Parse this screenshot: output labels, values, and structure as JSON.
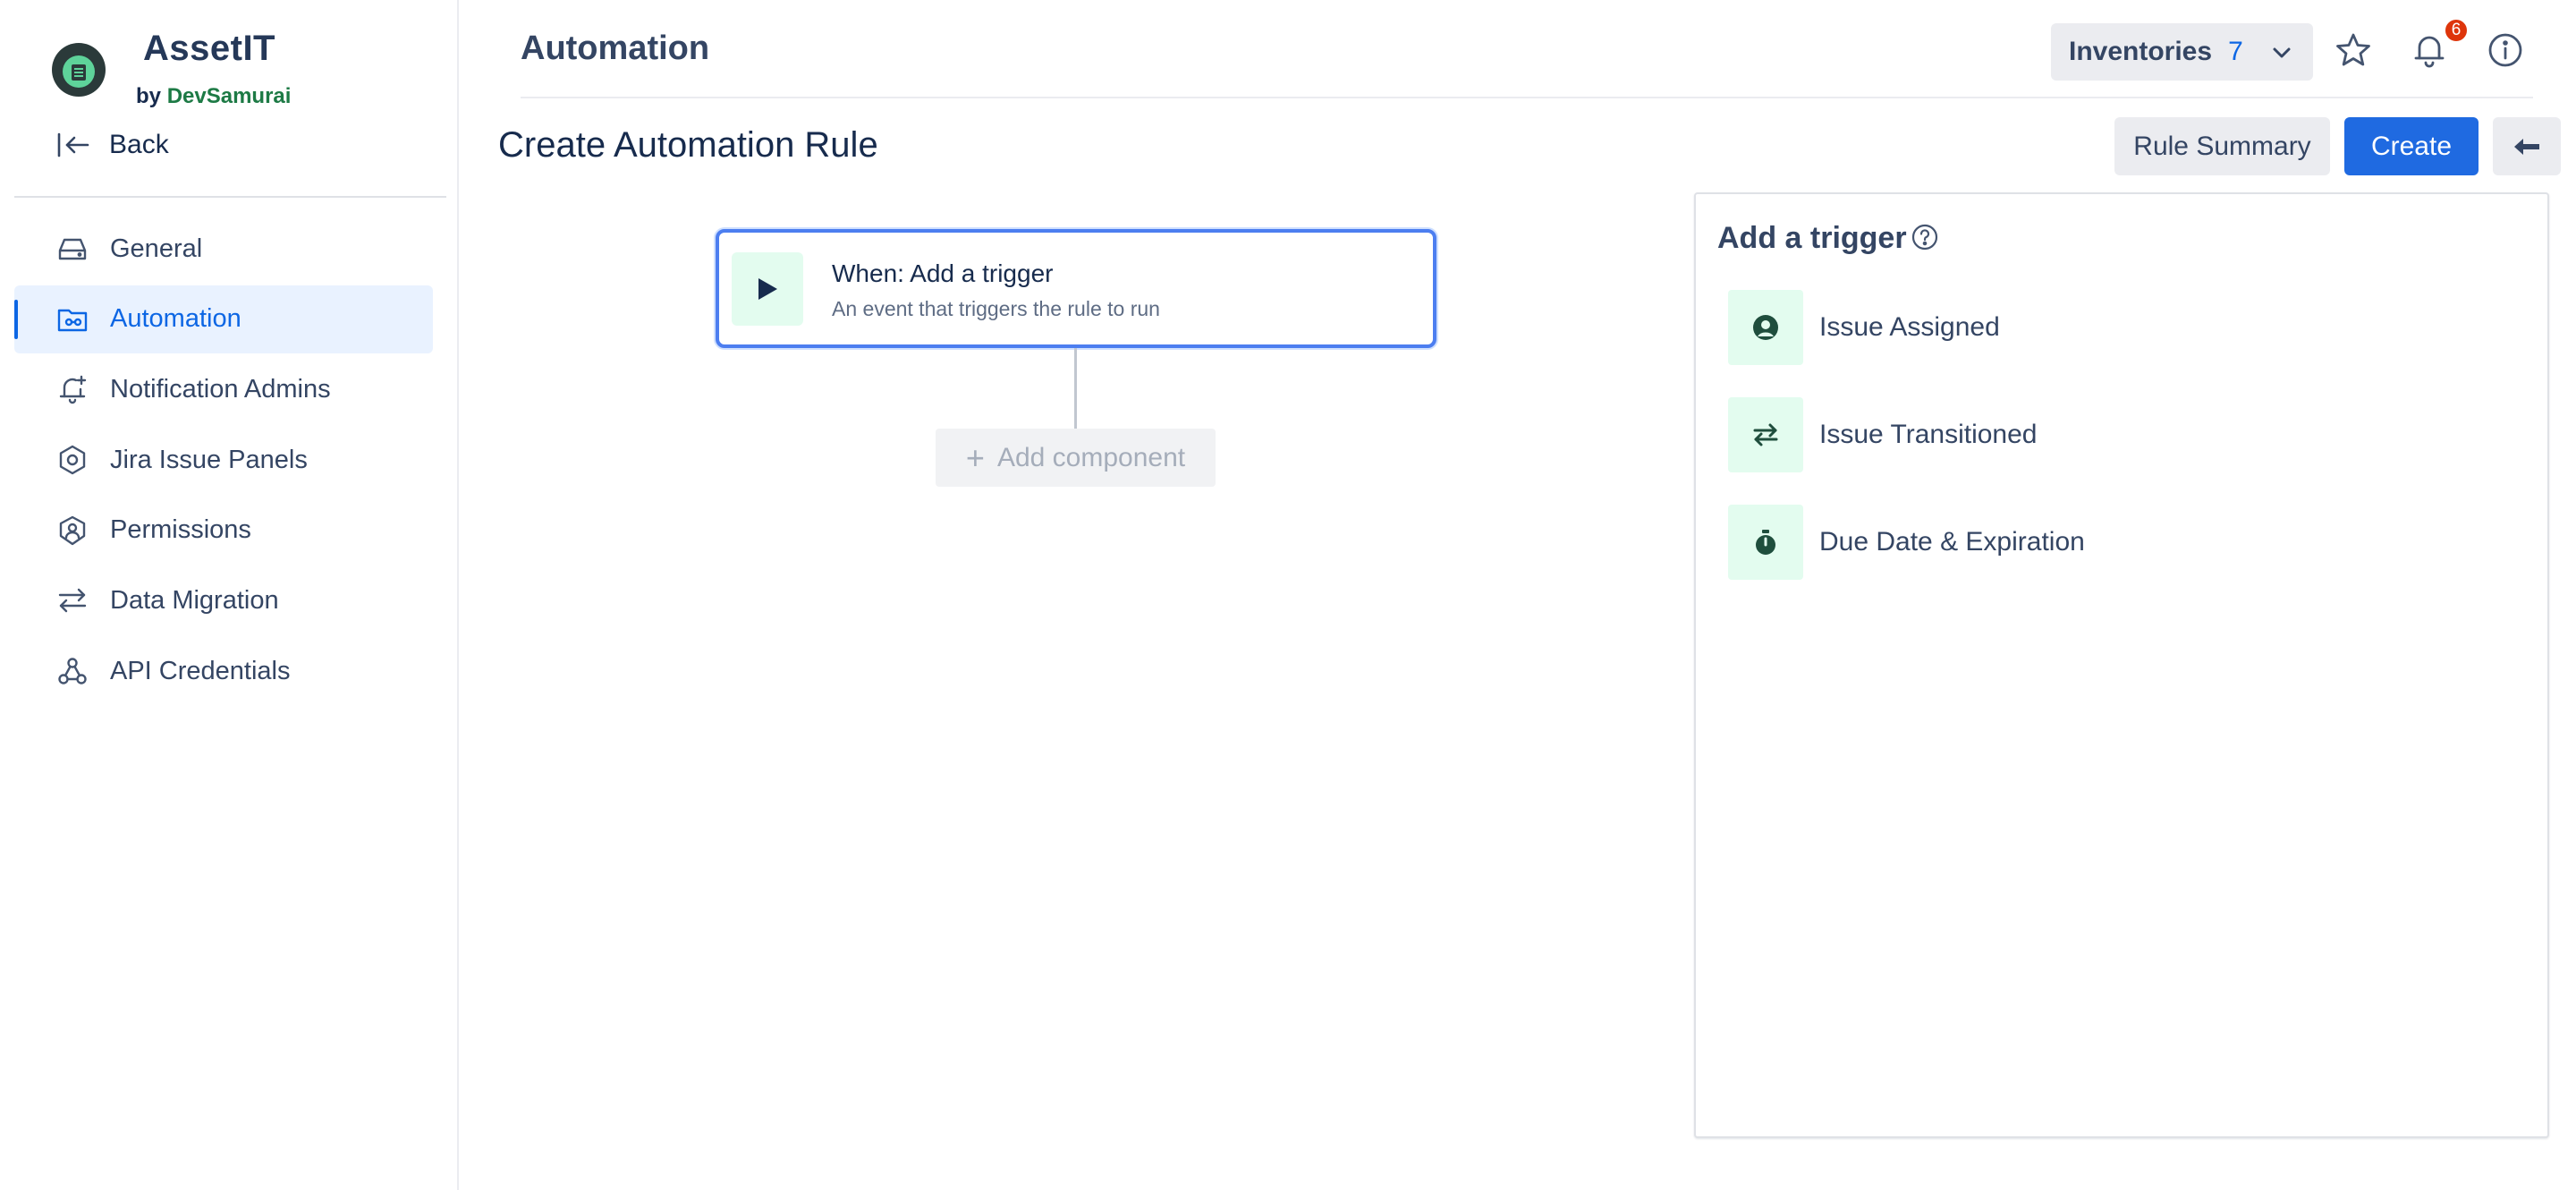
{
  "brand": {
    "name": "AssetIT",
    "by": "by",
    "company": "DevSamurai"
  },
  "sidebar": {
    "back_label": "Back",
    "items": [
      {
        "label": "General",
        "icon": "drive-icon",
        "active": false
      },
      {
        "label": "Automation",
        "icon": "automation-icon",
        "active": true
      },
      {
        "label": "Notification Admins",
        "icon": "bell-plus-icon",
        "active": false
      },
      {
        "label": "Jira Issue Panels",
        "icon": "hexagon-icon",
        "active": false
      },
      {
        "label": "Permissions",
        "icon": "shield-user-icon",
        "active": false
      },
      {
        "label": "Data Migration",
        "icon": "swap-arrows-icon",
        "active": false
      },
      {
        "label": "API Credentials",
        "icon": "webhook-icon",
        "active": false
      }
    ]
  },
  "header": {
    "title": "Automation",
    "inventories_label": "Inventories",
    "inventories_count": "7",
    "notifications_count": "6"
  },
  "subheader": {
    "title": "Create Automation Rule",
    "rule_summary_label": "Rule Summary",
    "create_label": "Create"
  },
  "canvas": {
    "trigger_title": "When: Add a trigger",
    "trigger_subtitle": "An event that triggers the rule to run",
    "add_component_label": "Add component"
  },
  "trigger_panel": {
    "title": "Add a trigger",
    "items": [
      {
        "label": "Issue Assigned",
        "icon": "user-circle-icon"
      },
      {
        "label": "Issue Transitioned",
        "icon": "swap-arrows-icon"
      },
      {
        "label": "Due Date & Expiration",
        "icon": "stopwatch-icon"
      }
    ]
  },
  "colors": {
    "accent": "#1f6ae1",
    "active_bg": "#e9f2ff",
    "icon_bg": "#e3fcef",
    "icon_fg": "#1f4e3d",
    "badge": "#de350b"
  }
}
